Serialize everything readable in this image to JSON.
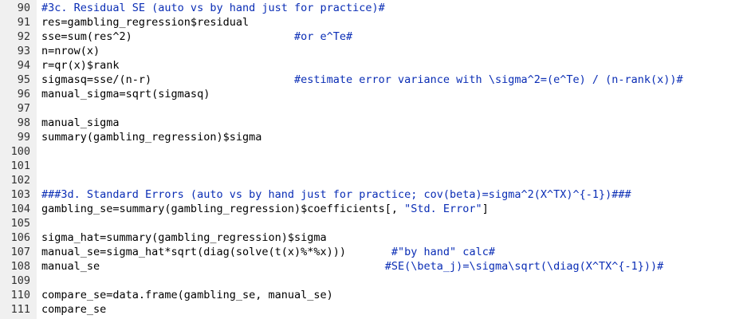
{
  "editor": {
    "lines": [
      {
        "no": "90",
        "code": "",
        "comment": "#3c. Residual SE (auto vs by hand just for practice)#"
      },
      {
        "no": "91",
        "code": "res=gambling_regression$residual",
        "comment": ""
      },
      {
        "no": "92",
        "code": "sse=sum(res^2)                         ",
        "comment": "#or e^Te#"
      },
      {
        "no": "93",
        "code": "n=nrow(x)",
        "comment": ""
      },
      {
        "no": "94",
        "code": "r=qr(x)$rank",
        "comment": ""
      },
      {
        "no": "95",
        "code": "sigmasq=sse/(n-r)                      ",
        "comment": "#estimate error variance with \\sigma^2=(e^Te) / (n-rank(x))#"
      },
      {
        "no": "96",
        "code": "manual_sigma=sqrt(sigmasq)",
        "comment": ""
      },
      {
        "no": "97",
        "code": "",
        "comment": ""
      },
      {
        "no": "98",
        "code": "manual_sigma",
        "comment": ""
      },
      {
        "no": "99",
        "code": "summary(gambling_regression)$sigma",
        "comment": ""
      },
      {
        "no": "100",
        "code": "",
        "comment": ""
      },
      {
        "no": "101",
        "code": "",
        "comment": ""
      },
      {
        "no": "102",
        "code": "",
        "comment": ""
      },
      {
        "no": "103",
        "code": "",
        "comment": "###3d. Standard Errors (auto vs by hand just for practice; cov(beta)=sigma^2(X^TX)^{-1})###"
      },
      {
        "no": "104",
        "code": "gambling_se=summary(gambling_regression)$coefficients[, \"Std. Error\"]",
        "comment": ""
      },
      {
        "no": "105",
        "code": "",
        "comment": ""
      },
      {
        "no": "106",
        "code": "sigma_hat=summary(gambling_regression)$sigma",
        "comment": ""
      },
      {
        "no": "107",
        "code": "manual_se=sigma_hat*sqrt(diag(solve(t(x)%*%x)))       ",
        "comment": "#\"by hand\" calc#"
      },
      {
        "no": "108",
        "code": "manual_se                                            ",
        "comment": "#SE(\\beta_j)=\\sigma\\sqrt(\\diag(X^TX^{-1}))#"
      },
      {
        "no": "109",
        "code": "",
        "comment": ""
      },
      {
        "no": "110",
        "code": "compare_se=data.frame(gambling_se, manual_se)",
        "comment": ""
      },
      {
        "no": "111",
        "code": "compare_se",
        "comment": ""
      }
    ]
  },
  "colors": {
    "comment": "#0a2db5",
    "code": "#000000",
    "gutter_bg": "#f0f0f0",
    "gutter_text": "#333333"
  }
}
